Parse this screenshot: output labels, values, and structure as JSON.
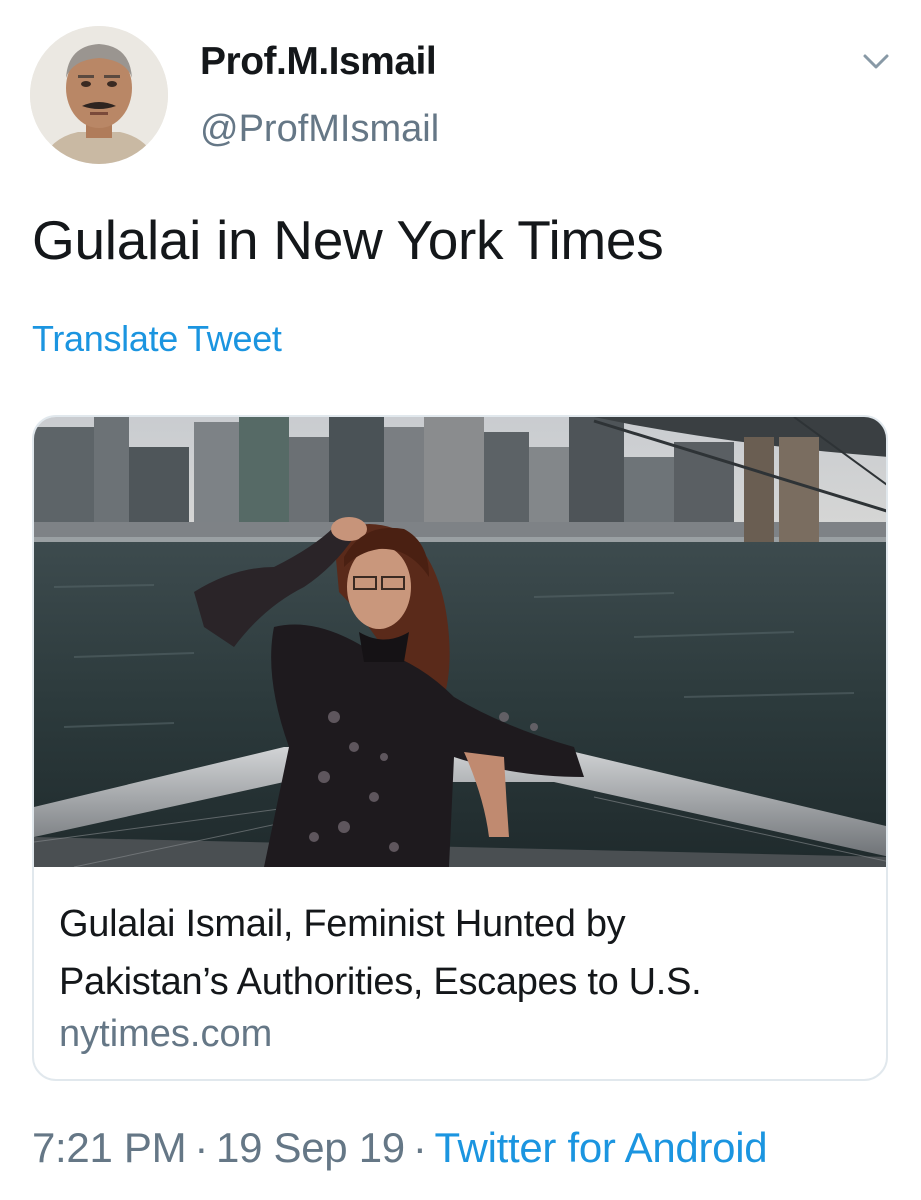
{
  "author": {
    "display_name": "Prof.M.Ismail",
    "handle": "@ProfMIsmail"
  },
  "tweet": {
    "text": "Gulalai in New York Times",
    "translate_label": "Translate Tweet"
  },
  "card": {
    "title_line1": "Gulalai Ismail, Feminist Hunted by",
    "title_line2": "Pakistan’s Authorities, Escapes to U.S.",
    "domain": "nytimes.com"
  },
  "meta": {
    "time": "7:21 PM",
    "separator": "·",
    "date": "19 Sep 19",
    "source": "Twitter for Android"
  },
  "icons": {
    "menu": "chevron-down-icon"
  },
  "colors": {
    "link": "#1b95e0",
    "secondary_text": "#657786",
    "primary_text": "#14171a",
    "card_border": "#e1e8ed"
  }
}
